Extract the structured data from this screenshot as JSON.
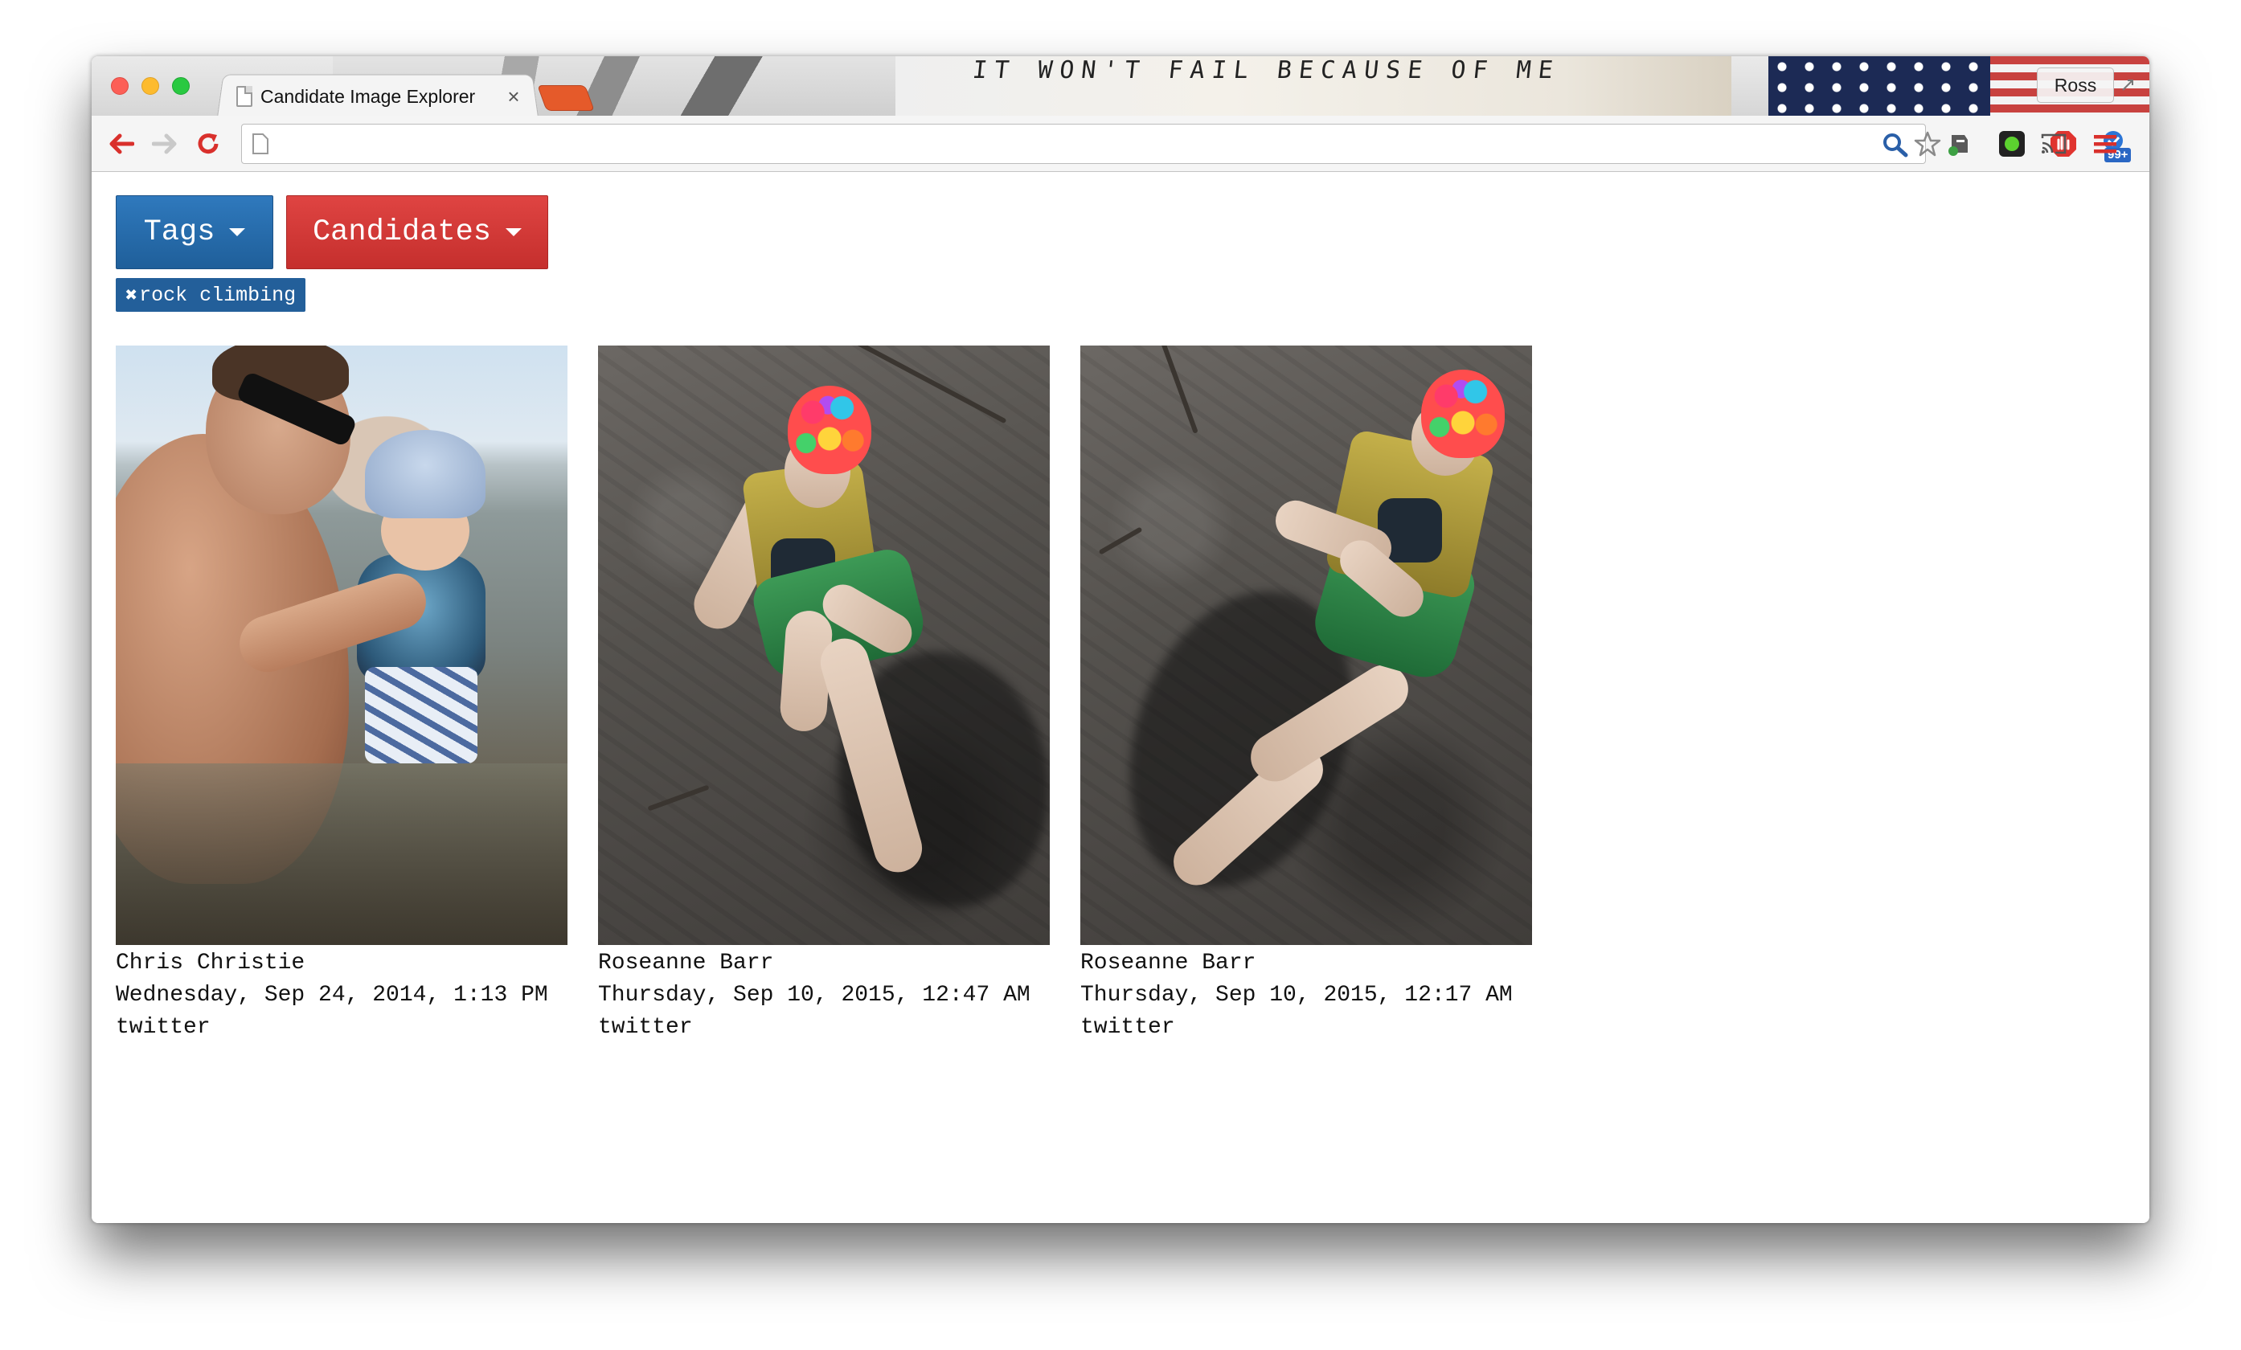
{
  "browser": {
    "tab_title": "Candidate Image Explorer",
    "tab_close": "×",
    "theme_text": "IT WON'T FAIL BECAUSE OF ME",
    "profile_name": "Ross",
    "url": "",
    "extension_badge": "99+"
  },
  "toolbar": {
    "tags_label": "Tags",
    "candidates_label": "Candidates"
  },
  "active_tag": {
    "remove_symbol": "✖",
    "label": "rock climbing"
  },
  "cards": [
    {
      "name": "Chris Christie",
      "date": "Wednesday, Sep 24, 2014, 1:13 PM",
      "source": "twitter"
    },
    {
      "name": "Roseanne Barr",
      "date": "Thursday, Sep 10, 2015, 12:47 AM",
      "source": "twitter"
    },
    {
      "name": "Roseanne Barr",
      "date": "Thursday, Sep 10, 2015, 12:17 AM",
      "source": "twitter"
    }
  ],
  "colors": {
    "tags_button": "#2a6fb0",
    "candidates_button": "#d43a38",
    "tag_chip": "#235f9a"
  },
  "icons": {
    "back": "arrow-left-icon",
    "forward": "arrow-right-icon",
    "reload": "reload-icon",
    "page": "page-icon",
    "search": "search-icon",
    "bookmark": "star-icon",
    "extensions": [
      "evernote-icon",
      "green-dot-icon",
      "adblock-icon",
      "notification-icon",
      "cast-icon"
    ],
    "menu": "hamburger-menu-icon"
  }
}
